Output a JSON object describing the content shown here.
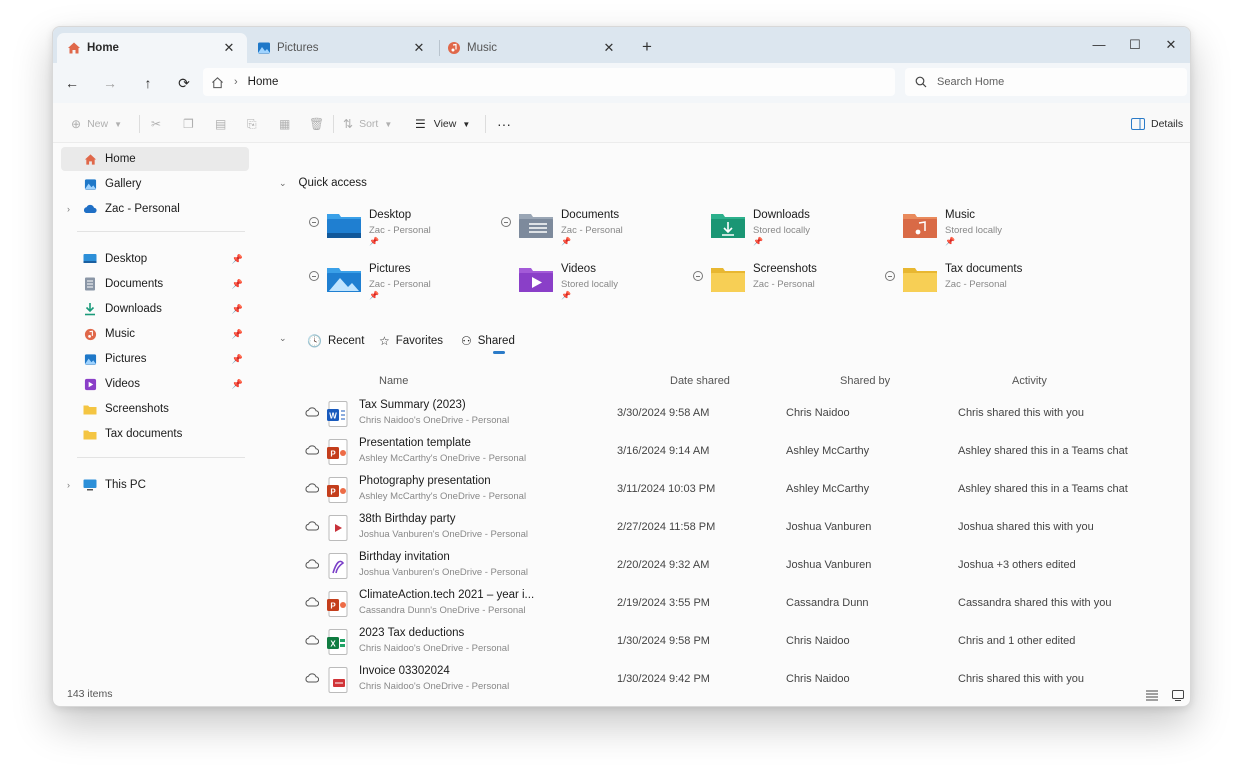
{
  "tabs": [
    {
      "label": "Home",
      "active": true
    },
    {
      "label": "Pictures",
      "active": false
    },
    {
      "label": "Music",
      "active": false
    }
  ],
  "address": {
    "crumb": "Home"
  },
  "search": {
    "placeholder": "Search Home"
  },
  "toolbar": {
    "new_label": "New",
    "sort_label": "Sort",
    "view_label": "View",
    "details_label": "Details"
  },
  "sidebar": {
    "top": [
      {
        "label": "Home",
        "icon": "home-icon"
      },
      {
        "label": "Gallery",
        "icon": "gallery-icon"
      },
      {
        "label": "Zac - Personal",
        "icon": "cloud-icon"
      }
    ],
    "pinned": [
      {
        "label": "Desktop",
        "icon": "desktop-icon"
      },
      {
        "label": "Documents",
        "icon": "documents-icon"
      },
      {
        "label": "Downloads",
        "icon": "downloads-icon"
      },
      {
        "label": "Music",
        "icon": "music-icon"
      },
      {
        "label": "Pictures",
        "icon": "pictures-icon"
      },
      {
        "label": "Videos",
        "icon": "videos-icon"
      },
      {
        "label": "Screenshots",
        "icon": "folder-icon"
      },
      {
        "label": "Tax documents",
        "icon": "folder-icon"
      }
    ],
    "thispc": "This PC"
  },
  "quick_access": {
    "title": "Quick access",
    "items": [
      {
        "name": "Desktop",
        "sub": "Zac - Personal",
        "icon": "desktop-folder-icon"
      },
      {
        "name": "Documents",
        "sub": "Zac - Personal",
        "icon": "documents-folder-icon"
      },
      {
        "name": "Downloads",
        "sub": "Stored locally",
        "icon": "downloads-folder-icon"
      },
      {
        "name": "Music",
        "sub": "Stored locally",
        "icon": "music-folder-icon"
      },
      {
        "name": "Pictures",
        "sub": "Zac - Personal",
        "icon": "pictures-folder-icon"
      },
      {
        "name": "Videos",
        "sub": "Stored locally",
        "icon": "videos-folder-icon"
      },
      {
        "name": "Screenshots",
        "sub": "Zac - Personal",
        "icon": "folder-icon"
      },
      {
        "name": "Tax documents",
        "sub": "Zac - Personal",
        "icon": "folder-icon"
      }
    ]
  },
  "file_tabs": {
    "recent": "Recent",
    "favorites": "Favorites",
    "shared": "Shared"
  },
  "columns": {
    "name": "Name",
    "date": "Date shared",
    "by": "Shared by",
    "activity": "Activity"
  },
  "files": [
    {
      "name": "Tax Summary (2023)",
      "loc": "Chris Naidoo's OneDrive - Personal",
      "date": "3/30/2024 9:58 AM",
      "by": "Chris Naidoo",
      "activity": "Chris shared this with you",
      "type": "word"
    },
    {
      "name": "Presentation template",
      "loc": "Ashley McCarthy's OneDrive - Personal",
      "date": "3/16/2024 9:14 AM",
      "by": "Ashley McCarthy",
      "activity": "Ashley shared this in a Teams chat",
      "type": "ppt"
    },
    {
      "name": "Photography presentation",
      "loc": "Ashley McCarthy's OneDrive - Personal",
      "date": "3/11/2024 10:03 PM",
      "by": "Ashley McCarthy",
      "activity": "Ashley shared this in a Teams chat",
      "type": "ppt"
    },
    {
      "name": "38th Birthday party",
      "loc": "Joshua Vanburen's OneDrive - Personal",
      "date": "2/27/2024 11:58 PM",
      "by": "Joshua Vanburen",
      "activity": "Joshua shared this with you",
      "type": "video"
    },
    {
      "name": "Birthday invitation",
      "loc": "Joshua Vanburen's OneDrive - Personal",
      "date": "2/20/2024 9:32 AM",
      "by": "Joshua Vanburen",
      "activity": "Joshua +3 others edited",
      "type": "design"
    },
    {
      "name": "ClimateAction.tech 2021 – year i...",
      "loc": "Cassandra Dunn's OneDrive - Personal",
      "date": "2/19/2024 3:55 PM",
      "by": "Cassandra Dunn",
      "activity": "Cassandra shared this with you",
      "type": "ppt"
    },
    {
      "name": "2023 Tax deductions",
      "loc": "Chris Naidoo's OneDrive - Personal",
      "date": "1/30/2024 9:58 PM",
      "by": "Chris Naidoo",
      "activity": "Chris and 1 other edited",
      "type": "excel"
    },
    {
      "name": "Invoice 03302024",
      "loc": "Chris Naidoo's OneDrive - Personal",
      "date": "1/30/2024 9:42 PM",
      "by": "Chris Naidoo",
      "activity": "Chris shared this with you",
      "type": "pdf"
    }
  ],
  "status": {
    "count": "143 items"
  },
  "colors": {
    "accent": "#2b7bc8",
    "tabbar": "#dce6ef"
  }
}
